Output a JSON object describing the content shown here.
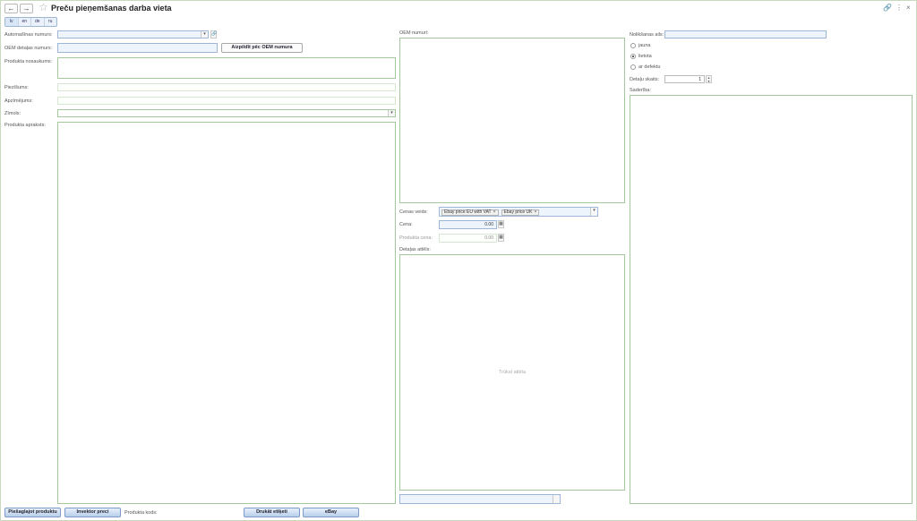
{
  "window": {
    "title": "Preču pieņemšanas darba vieta",
    "back_icon": "←",
    "forward_icon": "→",
    "star_icon": "☆",
    "link_icon": "🔗",
    "menu_icon": "⋮",
    "close_icon": "×"
  },
  "languages": [
    {
      "code": "lv",
      "active": true
    },
    {
      "code": "en",
      "active": false
    },
    {
      "code": "de",
      "active": false
    },
    {
      "code": "ru",
      "active": false
    }
  ],
  "left": {
    "auto_number_label": "Automašīnas numurs:",
    "auto_number_dropdown": "▾",
    "auto_number_open": "🔗",
    "oem_part_label": "OEM detaļas numurs:",
    "fill_by_oem_button": "Aizpildīt pēc OEM numura",
    "product_name_label": "Produkta nosaukums:",
    "note_label": "Piezīšums:",
    "description_short_label": "Apzīmējums:",
    "brand_label": "Zīmols:",
    "brand_dropdown": "▾",
    "product_description_label": "Produkta apraksts:"
  },
  "middle": {
    "oem_numbers_label": "OEM numuri:",
    "price_types_label": "Cenas veids:",
    "price_tags": [
      "Ebay price EU with VAT",
      "Ebay price UK"
    ],
    "price_label": "Cena:",
    "price_value": "0.00",
    "sell_price_label": "Produkta cena:",
    "sell_price_value": "0.00",
    "part_images_label": "Detaļas attēls:",
    "no_image_text": "Trūkst attēla"
  },
  "right": {
    "placement_label": "Nolikšanas ails:",
    "condition_options": [
      {
        "label": "jauna",
        "selected": false
      },
      {
        "label": "lietota",
        "selected": true
      },
      {
        "label": "ar defektu",
        "selected": false
      }
    ],
    "parts_count_label": "Detaļu skaits:",
    "parts_count_value": "1",
    "content_label": "Saderība:"
  },
  "footer": {
    "save_product_button": "Piešaglajot produktu",
    "inventory_button": "Invektor preci",
    "product_code_label": "Produkta kods:",
    "print_labels_button": "Drukāt etiķeti",
    "ebay_button": "eBay"
  }
}
